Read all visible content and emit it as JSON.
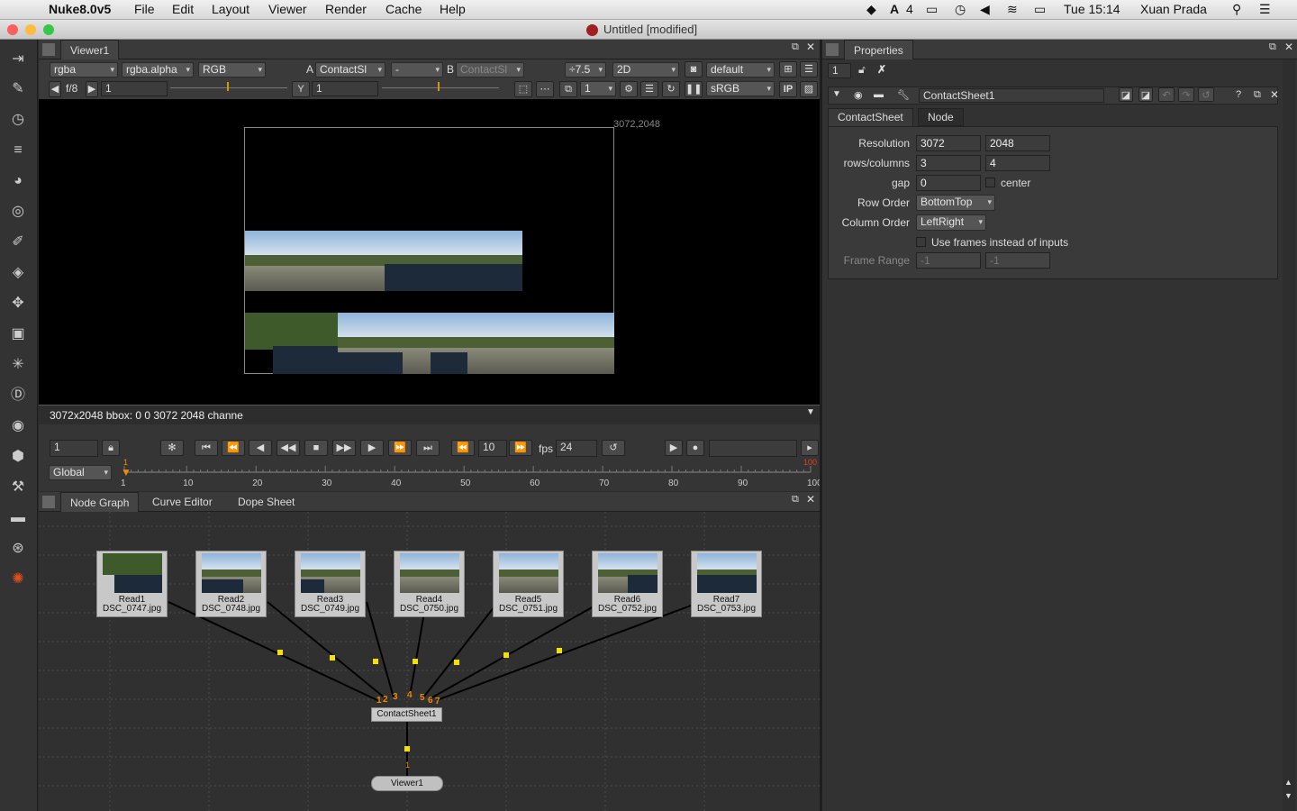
{
  "menubar": {
    "app_name": "Nuke8.0v5",
    "items": [
      "File",
      "Edit",
      "Layout",
      "Viewer",
      "Render",
      "Cache",
      "Help"
    ],
    "right": {
      "adobe_count": "4",
      "clock": "Tue 15:14",
      "user": "Xuan Prada"
    }
  },
  "window": {
    "title": "Untitled [modified]"
  },
  "viewer": {
    "tab": "Viewer1",
    "channels": "rgba",
    "alpha": "rgba.alpha",
    "display": "RGB",
    "input_a_label": "A",
    "input_a": "ContactSl",
    "compare_mode": "-",
    "input_b_label": "B",
    "input_b": "ContactSl",
    "gain": "÷7.5",
    "view_mode": "2D",
    "lut": "default",
    "fstop": "f/8",
    "gain_value": "1",
    "y_label": "Y",
    "gamma_value": "1",
    "proxy_value": "1",
    "colorspace": "sRGB",
    "ip_label": "IP",
    "format_corner": "3072,2048",
    "status": "3072x2048 bbox: 0 0 3072 2048 channe"
  },
  "timeline": {
    "frame": "1",
    "step": "10",
    "fps_label": "fps",
    "fps": "24",
    "range_mode": "Global",
    "start_marker": "1",
    "end_marker": "100",
    "ticks": [
      "1",
      "10",
      "20",
      "30",
      "40",
      "50",
      "60",
      "70",
      "80",
      "90",
      "100"
    ]
  },
  "nodegraph": {
    "tabs": [
      "Node Graph",
      "Curve Editor",
      "Dope Sheet"
    ],
    "read_nodes": [
      {
        "name": "Read1",
        "file": "DSC_0747.jpg"
      },
      {
        "name": "Read2",
        "file": "DSC_0748.jpg"
      },
      {
        "name": "Read3",
        "file": "DSC_0749.jpg"
      },
      {
        "name": "Read4",
        "file": "DSC_0750.jpg"
      },
      {
        "name": "Read5",
        "file": "DSC_0751.jpg"
      },
      {
        "name": "Read6",
        "file": "DSC_0752.jpg"
      },
      {
        "name": "Read7",
        "file": "DSC_0753.jpg"
      }
    ],
    "input_numbers": [
      "1",
      "2",
      "3",
      "4",
      "5",
      "6",
      "7"
    ],
    "contact_node": "ContactSheet1",
    "viewer_input": "1",
    "viewer_node": "Viewer1"
  },
  "properties": {
    "tab": "Properties",
    "max_panels": "1",
    "node_name": "ContactSheet1",
    "tabs": [
      "ContactSheet",
      "Node"
    ],
    "resolution_label": "Resolution",
    "resolution_w": "3072",
    "resolution_h": "2048",
    "rows_columns_label": "rows/columns",
    "rows": "3",
    "columns": "4",
    "gap_label": "gap",
    "gap": "0",
    "center_label": "center",
    "row_order_label": "Row Order",
    "row_order": "BottomTop",
    "column_order_label": "Column Order",
    "column_order": "LeftRight",
    "use_frames_label": "Use frames instead of inputs",
    "frame_range_label": "Frame Range",
    "frame_range_start": "-1",
    "frame_range_end": "-1"
  },
  "colors": {
    "accent": "#f08c00",
    "node_bg": "#c8c8c8",
    "dot": "#f5e000"
  }
}
